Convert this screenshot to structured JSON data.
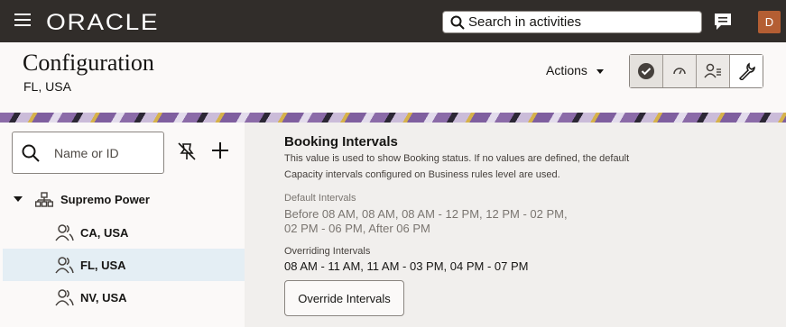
{
  "topbar": {
    "brand": "ORACLE",
    "search_placeholder": "Search in activities",
    "avatar_initial": "D",
    "icons": [
      "menu-icon",
      "search-icon",
      "chat-icon"
    ]
  },
  "header": {
    "title": "Configuration",
    "subtitle": "FL, USA",
    "actions_label": "Actions",
    "toolbar_icons": [
      "check-circle-icon",
      "gauge-icon",
      "user-settings-icon",
      "wrench-icon"
    ]
  },
  "left": {
    "search_placeholder": "Name or ID",
    "tree": {
      "root_label": "Supremo Power",
      "items": [
        {
          "label": "CA, USA",
          "selected": false
        },
        {
          "label": "FL, USA",
          "selected": true
        },
        {
          "label": "NV, USA",
          "selected": false
        }
      ]
    }
  },
  "booking": {
    "title": "Booking Intervals",
    "description_line1": "This value is used to show Booking status. If no values are defined, the default",
    "description_line2": "Capacity intervals configured on Business rules level are used.",
    "default_label": "Default Intervals",
    "default_line1": "Before 08 AM,  08 AM,  08 AM - 12 PM,  12 PM - 02 PM,",
    "default_line2": "02 PM - 06 PM,  After 06 PM",
    "overriding_label": "Overriding Intervals",
    "overriding_values": "08 AM - 11 AM,  11 AM - 03 PM,  04 PM - 07 PM",
    "override_button": "Override Intervals"
  },
  "colors": {
    "topbar": "#312d2a",
    "avatar": "#b45e33",
    "selected_row": "#e4eef4"
  }
}
